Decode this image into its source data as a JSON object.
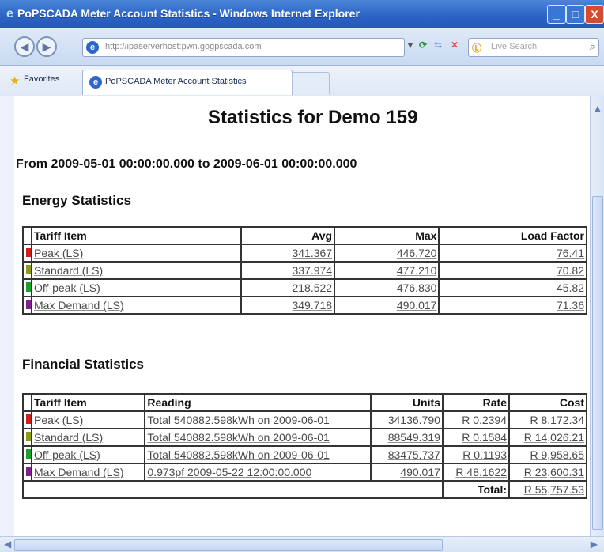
{
  "window": {
    "title": "PoPSCADA Meter Account Statistics - Windows Internet Explorer",
    "buttons": {
      "minimize": "_",
      "maximize": "□",
      "close": "X"
    }
  },
  "browser": {
    "address_url": "http://ipaserverhost:pwn.gogpscada.com",
    "search_placeholder": "Live Search",
    "favorites_label": "Favorites",
    "tab_label": "PoPSCADA Meter Account Statistics"
  },
  "page": {
    "title": "Statistics for Demo 159",
    "period": "From 2009-05-01 00:00:00.000 to 2009-06-01 00:00:00.000",
    "energy_section_title": "Energy Statistics",
    "financial_section_title": "Financial Statistics"
  },
  "energy_table": {
    "headers": [
      "Tariff Item",
      "Avg",
      "Max",
      "Load Factor"
    ],
    "rows": [
      {
        "color": "#cc1f1f",
        "tariff_item": "Peak (LS)",
        "avg": "341.367",
        "max": "446.720",
        "load_factor": "76.41"
      },
      {
        "color": "#8c9a1a",
        "tariff_item": "Standard (LS)",
        "avg": "337.974",
        "max": "477.210",
        "load_factor": "70.82"
      },
      {
        "color": "#1a9f2b",
        "tariff_item": "Off-peak (LS)",
        "avg": "218.522",
        "max": "476.830",
        "load_factor": "45.82"
      },
      {
        "color": "#7d1f8e",
        "tariff_item": "Max Demand (LS)",
        "avg": "349.718",
        "max": "490.017",
        "load_factor": "71.36"
      }
    ]
  },
  "financial_table": {
    "headers": [
      "Tariff Item",
      "Reading",
      "Units",
      "Rate",
      "Cost"
    ],
    "rows": [
      {
        "color": "#cc1f1f",
        "tariff_item": "Peak (LS)",
        "reading": "Total 540882.598kWh on 2009-06-01",
        "units": "34136.790",
        "rate": "R 0.2394",
        "cost": "R 8,172.34"
      },
      {
        "color": "#8c9a1a",
        "tariff_item": "Standard (LS)",
        "reading": "Total 540882.598kWh on 2009-06-01",
        "units": "88549.319",
        "rate": "R 0.1584",
        "cost": "R 14,026.21"
      },
      {
        "color": "#1a9f2b",
        "tariff_item": "Off-peak (LS)",
        "reading": "Total 540882.598kWh on 2009-06-01",
        "units": "83475.737",
        "rate": "R 0.1193",
        "cost": "R 9,958.65"
      },
      {
        "color": "#7d1f8e",
        "tariff_item": "Max Demand (LS)",
        "reading": "0.973pf 2009-05-22 12:00:00.000",
        "units": "490.017",
        "rate": "R 48.1622",
        "cost": "R 23,600.31"
      }
    ],
    "total_label": "Total:",
    "total_cost": "R 55,757.53"
  }
}
